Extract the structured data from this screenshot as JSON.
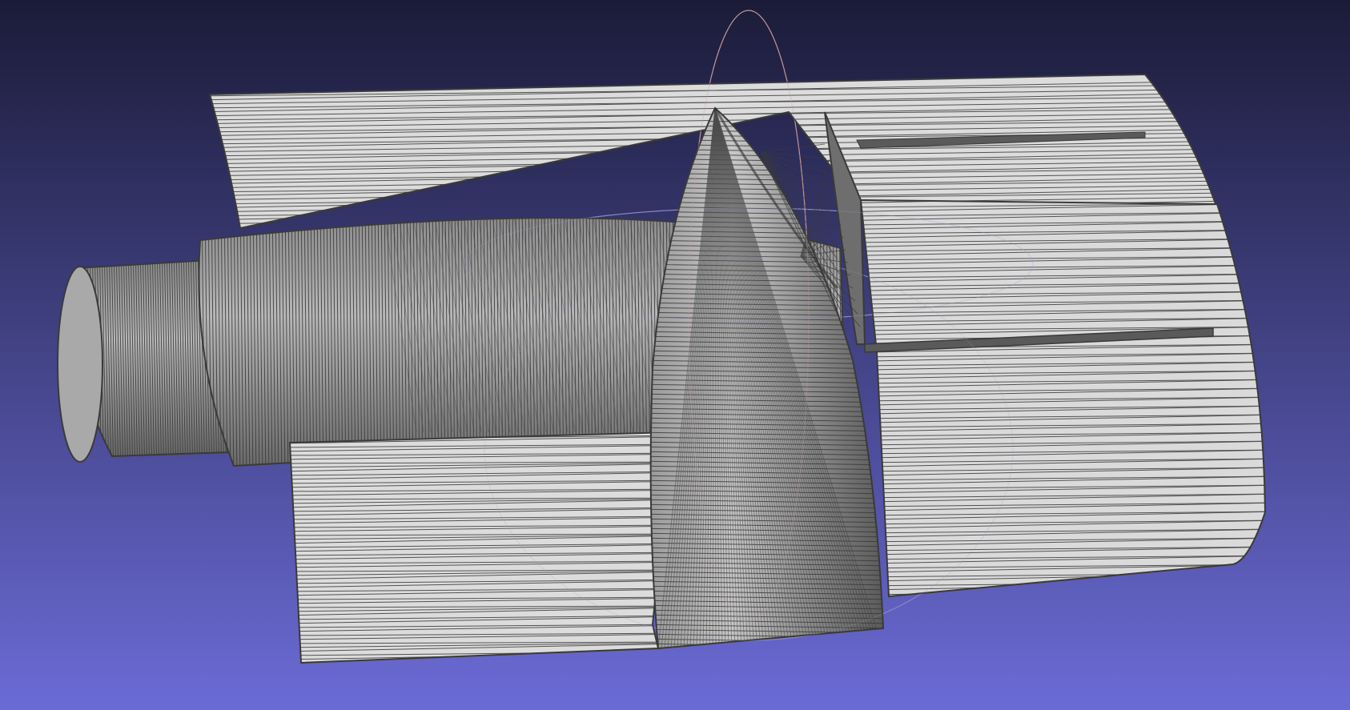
{
  "viewer": {
    "background_top": "#1b1b38",
    "background_bottom": "#6b6bd6",
    "mesh_fill": "#dcdcdc",
    "mesh_fill_shadow": "#c4c4c4",
    "wire_color": "#3a3a3a",
    "trackball_color_1": "#c89a9a",
    "trackball_color_2": "#9a9ad0"
  }
}
